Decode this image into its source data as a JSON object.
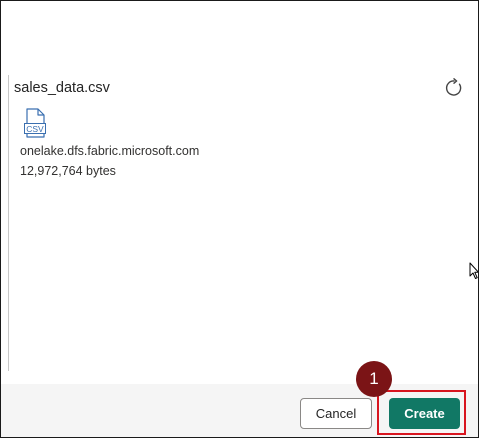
{
  "file": {
    "name": "sales_data.csv",
    "type_icon_label": "CSV",
    "host": "onelake.dfs.fabric.microsoft.com",
    "size": "12,972,764 bytes"
  },
  "icons": {
    "refresh": "refresh-icon",
    "file_type": "csv-file-icon",
    "cursor": "mouse-pointer-icon"
  },
  "footer": {
    "cancel_label": "Cancel",
    "create_label": "Create"
  },
  "annotation": {
    "step_number": "1",
    "highlight_color": "#d8151f",
    "badge_color": "#7b1416"
  },
  "colors": {
    "primary_button": "#117865",
    "footer_background": "#f5f5f5",
    "icon_accent": "#3a6fb0"
  }
}
